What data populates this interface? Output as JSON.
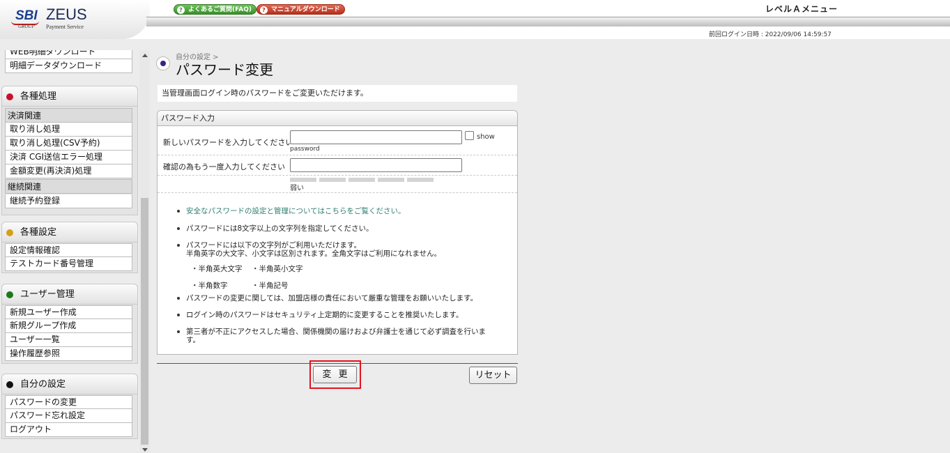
{
  "header": {
    "brand_sbi": "SBI",
    "brand_sbi_sub": "GROUP",
    "brand_zeus": "ZEUS",
    "brand_zeus_sub": "Payment Service",
    "faq_label": "よくあるご質問(FAQ)",
    "manual_label": "マニュアルダウンロード",
    "menu_title": "レベルＡメニュー",
    "last_login": "前回ログイン日時 : 2022/09/06 14:59:57"
  },
  "sidebar": {
    "top_links": [
      "WEB明細ダウンロード",
      "明細データダウンロード"
    ],
    "sections": [
      {
        "title": "各種処理",
        "dot_color": "#c8102e",
        "groups": [
          {
            "label": "決済関連",
            "items": [
              "取り消し処理",
              "取り消し処理(CSV予約)",
              "決済 CGI送信エラー処理",
              "金額変更(再決済)処理"
            ]
          },
          {
            "label": "継続関連",
            "items": [
              "継続予約登録"
            ]
          }
        ]
      },
      {
        "title": "各種設定",
        "dot_color": "#d4a017",
        "items": [
          "設定情報確認",
          "テストカード番号管理"
        ]
      },
      {
        "title": "ユーザー管理",
        "dot_color": "#1a7a1a",
        "items": [
          "新規ユーザー作成",
          "新規グループ作成",
          "ユーザー一覧",
          "操作履歴参照"
        ]
      },
      {
        "title": "自分の設定",
        "dot_color": "#111111",
        "items": [
          "パスワードの変更",
          "パスワード忘れ設定",
          "ログアウト"
        ]
      }
    ]
  },
  "main": {
    "breadcrumb": "自分の設定 >",
    "title": "パスワード変更",
    "intro": "当管理画面ログイン時のパスワードをご変更いただけます。",
    "form": {
      "heading": "パスワード入力",
      "new_label": "新しいパスワードを入力してください",
      "new_value": "",
      "show_label": "show",
      "show_label2": "password",
      "confirm_label": "確認の為もう一度入力してください",
      "confirm_value": "",
      "strength_label": "弱い",
      "strength_segments": 5
    },
    "notes": {
      "link": "安全なパスワードの設定と管理についてはこちらをご覧ください。",
      "n1": "パスワードには8文字以上の文字列を指定してください。",
      "n2": "パスワードには以下の文字列がご利用いただけます。",
      "n2b": "半角英字の大文字、小文字は区別されます。全角文字はご利用になれません。",
      "c1": "・半角英大文字",
      "c2": "・半角英小文字",
      "c3": "・半角数字",
      "c4": "・半角記号",
      "n3": "パスワードの変更に関しては、加盟店様の責任において厳重な管理をお願いいたします。",
      "n4": "ログイン時のパスワードはセキュリティ上定期的に変更することを推奨いたします。",
      "n5": "第三者が不正にアクセスした場合、関係機関の届けおよび弁護士を通じて必ず調査を行いま",
      "n5b": "す。"
    },
    "buttons": {
      "change": "変更",
      "reset": "リセット"
    }
  }
}
